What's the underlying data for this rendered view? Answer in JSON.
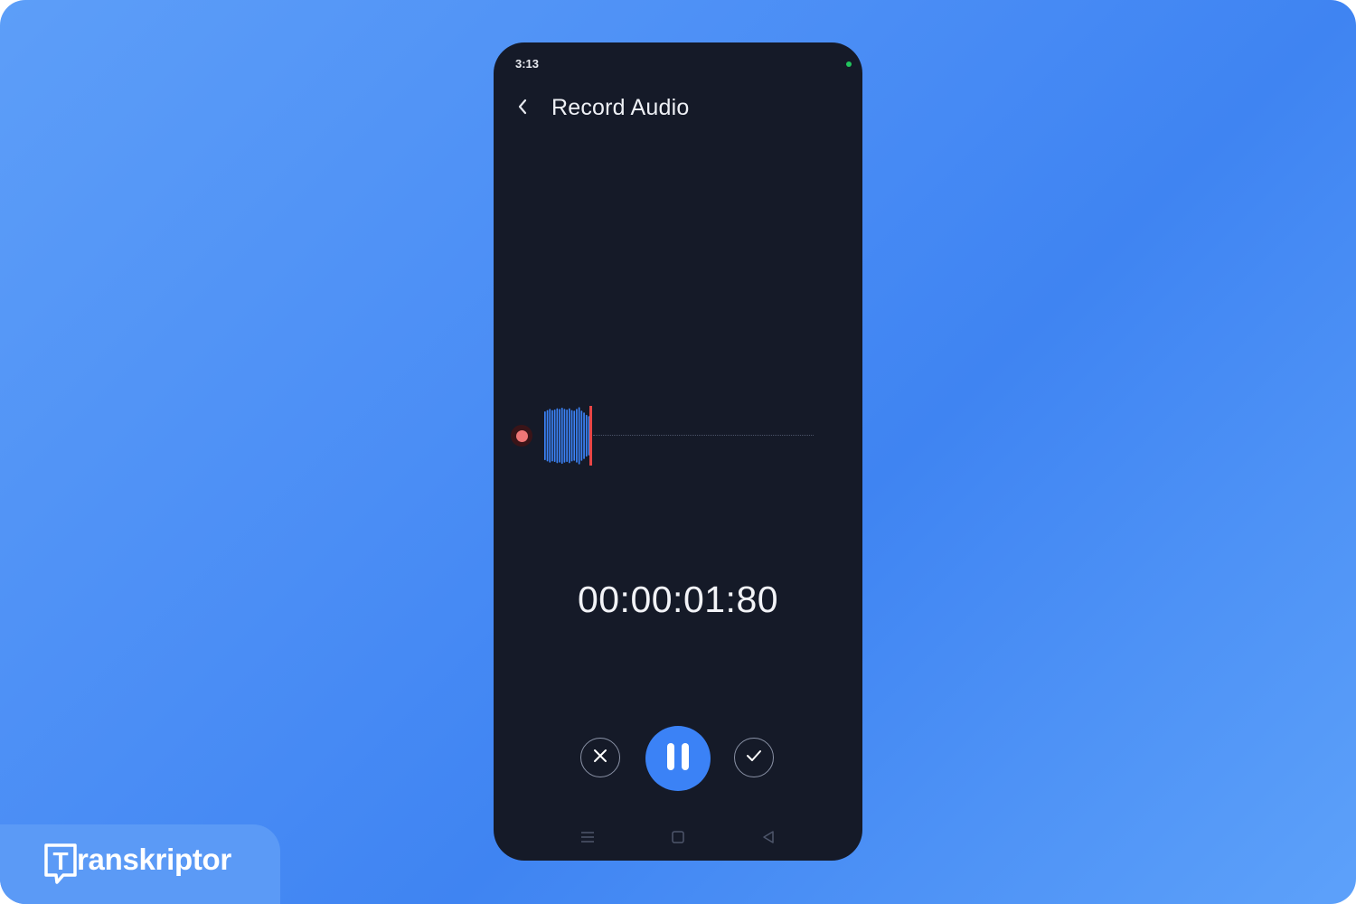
{
  "status_bar": {
    "time": "3:13"
  },
  "header": {
    "title": "Record Audio"
  },
  "recorder": {
    "timer": "00:00:01:80",
    "waveform_levels": [
      0.82,
      0.86,
      0.9,
      0.86,
      0.88,
      0.92,
      0.9,
      0.94,
      0.9,
      0.88,
      0.92,
      0.86,
      0.84,
      0.9,
      0.96,
      0.84,
      0.78,
      0.7,
      0.66
    ]
  },
  "controls": {
    "discard_icon": "close-icon",
    "pause_icon": "pause-icon",
    "confirm_icon": "check-icon"
  },
  "nav_bar": {
    "items": [
      "menu-icon",
      "home-icon",
      "back-triangle-icon"
    ]
  },
  "brand": {
    "name": "ranskriptor",
    "logo_letter": "T"
  },
  "colors": {
    "background_gradient": [
      "#5d9ef8",
      "#3f84f2",
      "#5da1fa"
    ],
    "phone_background": "#151a28",
    "accent": "#3b82f6",
    "recording_dot": "#ef7676",
    "playhead": "#e84545",
    "status_dot": "#22c55e"
  }
}
